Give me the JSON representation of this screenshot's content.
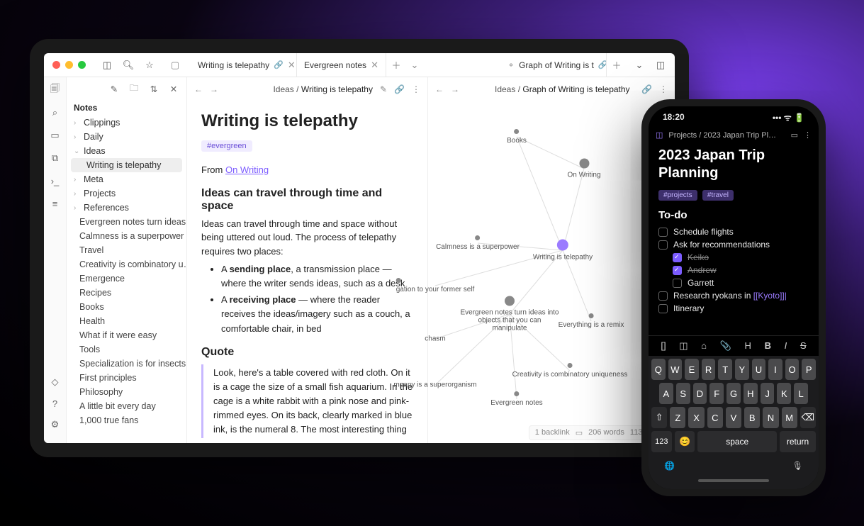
{
  "tablet": {
    "tabs": {
      "left_group": [
        {
          "label": "Writing is telepathy",
          "linked": true
        },
        {
          "label": "Evergreen notes",
          "linked": false
        }
      ],
      "right_group": [
        {
          "label": "Graph of Writing is t",
          "linked": true,
          "graph": true
        }
      ]
    },
    "sidebar": {
      "header": "Notes",
      "folders": [
        {
          "label": "Clippings",
          "open": false
        },
        {
          "label": "Daily",
          "open": false
        },
        {
          "label": "Ideas",
          "open": true,
          "children": [
            {
              "label": "Writing is telepathy",
              "selected": true
            }
          ]
        },
        {
          "label": "Meta",
          "open": false
        },
        {
          "label": "Projects",
          "open": false
        },
        {
          "label": "References",
          "open": false
        }
      ],
      "leaves": [
        "Evergreen notes turn ideas…",
        "Calmness is a superpower",
        "Travel",
        "Creativity is combinatory u…",
        "Emergence",
        "Recipes",
        "Books",
        "Health",
        "What if it were easy",
        "Tools",
        "Specialization is for insects",
        "First principles",
        "Philosophy",
        "A little bit every day",
        "1,000 true fans"
      ]
    },
    "editor": {
      "crumb_parent": "Ideas",
      "crumb_current": "Writing is telepathy",
      "title": "Writing is telepathy",
      "tag": "#evergreen",
      "from_prefix": "From ",
      "from_link": "On Writing",
      "h2_a": "Ideas can travel through time and space",
      "p1": "Ideas can travel through time and space without being uttered out loud. The process of telepathy requires two places:",
      "li1_b": "sending place",
      "li1_rest": ", a transmission place — where the writer sends ideas, such as a desk",
      "li2_b": "receiving place",
      "li2_rest": " — where the reader receives the ideas/imagery such as a couch, a comfortable chair, in bed",
      "h2_b": "Quote",
      "quote": "Look, here's a table covered with red cloth. On it is a cage the size of a small fish aquarium. In the cage is a white rabbit with a pink nose and pink-rimmed eyes. On its back, clearly marked in blue ink, is the numeral 8. The most interesting thing"
    },
    "graph": {
      "crumb_parent": "Ideas",
      "crumb_current": "Graph of Writing is telepathy",
      "nodes": {
        "books": "Books",
        "onwriting": "On Writing",
        "calm": "Calmness is a superpower",
        "current": "Writing is telepathy",
        "gation": "gation to your former self",
        "evergreen_turn": "Evergreen notes turn ideas into objects that you can manipulate",
        "remix": "Everything is a remix",
        "chasm": "chasm",
        "creativity": "Creativity is combinatory uniqueness",
        "evergreen": "Evergreen notes",
        "superorg": "mpany is a superorganism"
      },
      "status": {
        "backlinks": "1 backlink",
        "words": "206 words",
        "chars": "1139 char"
      }
    }
  },
  "phone": {
    "time": "18:20",
    "crumb_parent": "Projects",
    "crumb_current": "2023 Japan Trip Pl…",
    "title": "2023 Japan Trip Planning",
    "tags": [
      "#projects",
      "#travel"
    ],
    "h2": "To-do",
    "todos": [
      {
        "text": "Schedule flights",
        "done": false,
        "indent": 0
      },
      {
        "text": "Ask for recommendations",
        "done": false,
        "indent": 0
      },
      {
        "text": "Keiko",
        "done": true,
        "indent": 1
      },
      {
        "text": "Andrew",
        "done": true,
        "indent": 1
      },
      {
        "text": "Garrett",
        "done": false,
        "indent": 1
      }
    ],
    "research_prefix": "Research ryokans in ",
    "research_link": "[[Kyoto]]",
    "itinerary": "Itinerary",
    "toolbar": [
      "[]",
      "◫",
      "⌂",
      "📎",
      "H",
      "B",
      "I",
      "S"
    ],
    "keyboard": {
      "r1": [
        "Q",
        "W",
        "E",
        "R",
        "T",
        "Y",
        "U",
        "I",
        "O",
        "P"
      ],
      "r2": [
        "A",
        "S",
        "D",
        "F",
        "G",
        "H",
        "J",
        "K",
        "L"
      ],
      "r3": [
        "⇧",
        "Z",
        "X",
        "C",
        "V",
        "B",
        "N",
        "M",
        "⌫"
      ],
      "num": "123",
      "emoji": "😊",
      "space": "space",
      "ret": "return"
    }
  }
}
